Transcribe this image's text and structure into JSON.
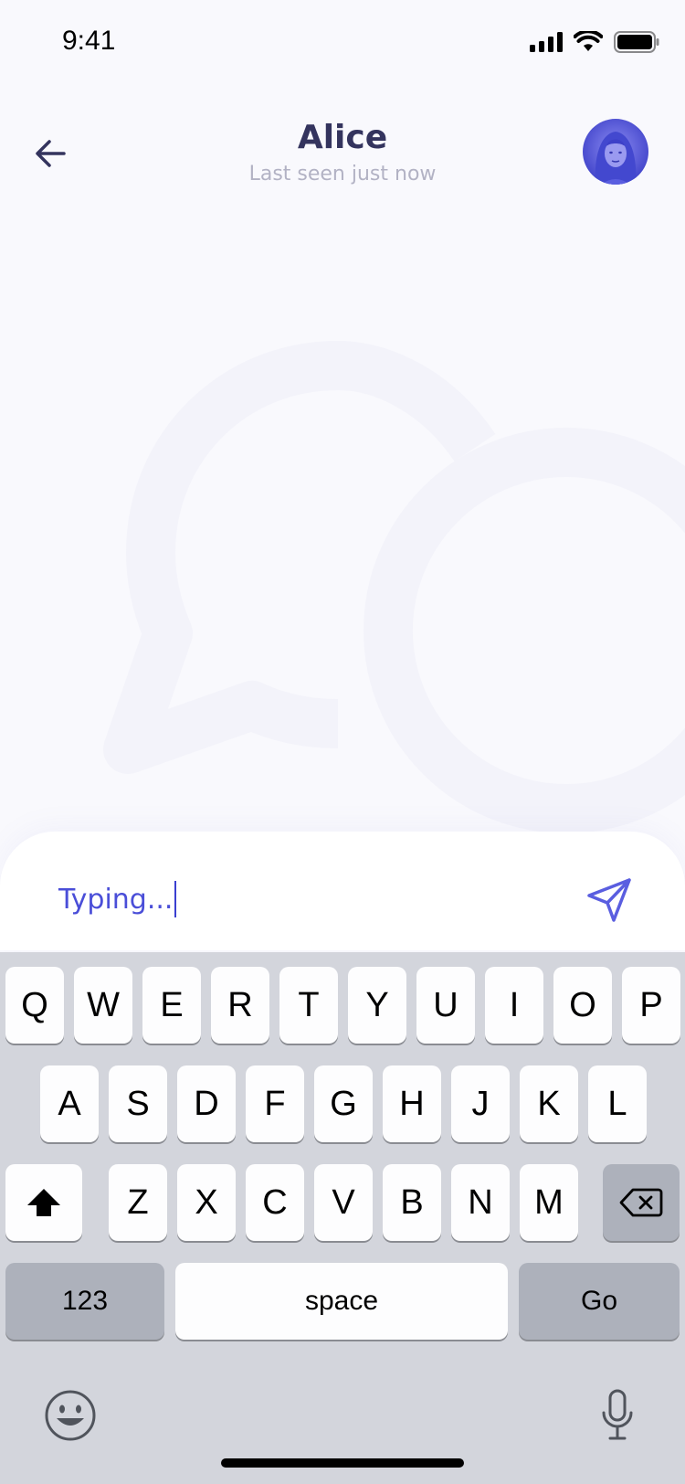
{
  "status": {
    "time": "9:41",
    "icons": [
      "signal-icon",
      "wifi-icon",
      "battery-icon"
    ]
  },
  "header": {
    "title": "Alice",
    "subtitle": "Last seen just now",
    "back_icon": "arrow-left-icon"
  },
  "composer": {
    "value": "Typing...",
    "send_icon": "send-icon"
  },
  "keyboard": {
    "row1": [
      "Q",
      "W",
      "E",
      "R",
      "T",
      "Y",
      "U",
      "I",
      "O",
      "P"
    ],
    "row2": [
      "A",
      "S",
      "D",
      "F",
      "G",
      "H",
      "J",
      "K",
      "L"
    ],
    "row3": [
      "Z",
      "X",
      "C",
      "V",
      "B",
      "N",
      "M"
    ],
    "numbers_label": "123",
    "space_label": "space",
    "go_label": "Go",
    "shift_icon": "shift-icon",
    "delete_icon": "backspace-icon",
    "emoji_icon": "emoji-icon",
    "mic_icon": "microphone-icon"
  },
  "colors": {
    "accent": "#4a4ed8",
    "title": "#34345e",
    "subtitle": "#b2b2c4",
    "background": "#f9f9fd",
    "keyboard": "#d3d5dc"
  }
}
